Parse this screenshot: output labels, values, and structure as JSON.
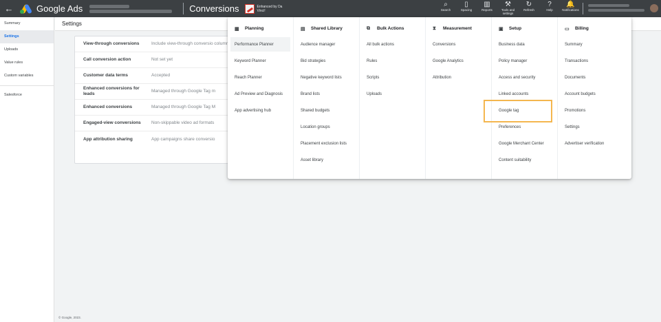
{
  "topbar": {
    "back_icon": "arrow-left-icon",
    "app_name": "Google Ads",
    "page_title": "Conversions",
    "promo_text": "Enhanced by Da Vinci!",
    "tools": [
      {
        "label": "Search",
        "icon": "search-icon",
        "glyph": "⌕"
      },
      {
        "label": "Spacing",
        "icon": "spacing-icon",
        "glyph": "▯"
      },
      {
        "label": "Reports",
        "icon": "reports-icon",
        "glyph": "▥"
      },
      {
        "label": "Tools and settings",
        "icon": "wrench-icon",
        "glyph": "⚒"
      },
      {
        "label": "Refresh",
        "icon": "refresh-icon",
        "glyph": "↻"
      },
      {
        "label": "Help",
        "icon": "help-icon",
        "glyph": "?"
      },
      {
        "label": "Notifications",
        "icon": "bell-icon",
        "glyph": "🔔"
      }
    ]
  },
  "sidebar": {
    "items": [
      {
        "label": "Summary"
      },
      {
        "label": "Settings"
      },
      {
        "label": "Uploads"
      },
      {
        "label": "Value rules"
      },
      {
        "label": "Custom variables"
      },
      {
        "label": "Salesforce"
      }
    ]
  },
  "main": {
    "header": "Settings",
    "rows": [
      {
        "name": "View-through conversions",
        "value": "Include view-through conversio columns"
      },
      {
        "name": "Call conversion action",
        "value": "Not set yet"
      },
      {
        "name": "Customer data terms",
        "value": "Accepted"
      },
      {
        "name": "Enhanced conversions for leads",
        "value": "Managed through Google Tag m"
      },
      {
        "name": "Enhanced conversions",
        "value": "Managed through Google Tag M"
      },
      {
        "name": "Engaged-view conversions",
        "value": "Non-skippable video ad formats"
      },
      {
        "name": "App attribution sharing",
        "value": "App campaigns share conversio"
      }
    ],
    "footer": "© Google, 2023."
  },
  "menu": {
    "columns": [
      {
        "title": "Planning",
        "icon": "calendar-icon",
        "glyph": "▦",
        "items": [
          "Performance Planner",
          "Keyword Planner",
          "Reach Planner",
          "Ad Preview and Diagnosis",
          "App advertising hub"
        ]
      },
      {
        "title": "Shared Library",
        "icon": "library-icon",
        "glyph": "▤",
        "items": [
          "Audience manager",
          "Bid strategies",
          "Negative keyword lists",
          "Brand lists",
          "Shared budgets",
          "Location groups",
          "Placement exclusion lists",
          "Asset library"
        ]
      },
      {
        "title": "Bulk Actions",
        "icon": "bulk-actions-icon",
        "glyph": "⧉",
        "items": [
          "All bulk actions",
          "Rules",
          "Scripts",
          "Uploads"
        ]
      },
      {
        "title": "Measurement",
        "icon": "hourglass-icon",
        "glyph": "⧗",
        "items": [
          "Conversions",
          "Google Analytics",
          "Attribution"
        ]
      },
      {
        "title": "Setup",
        "icon": "setup-icon",
        "glyph": "▣",
        "items": [
          "Business data",
          "Policy manager",
          "Access and security",
          "Linked accounts",
          "Google tag",
          "Preferences",
          "Google Merchant Center",
          "Content suitability"
        ]
      },
      {
        "title": "Billing",
        "icon": "credit-card-icon",
        "glyph": "▭",
        "items": [
          "Summary",
          "Transactions",
          "Documents",
          "Account budgets",
          "Promotions",
          "Settings",
          "Advertiser verification"
        ]
      }
    ]
  },
  "colors": {
    "topbar": "#3c4043",
    "accent": "#1a73e8",
    "highlight_border": "#f4b64e"
  }
}
